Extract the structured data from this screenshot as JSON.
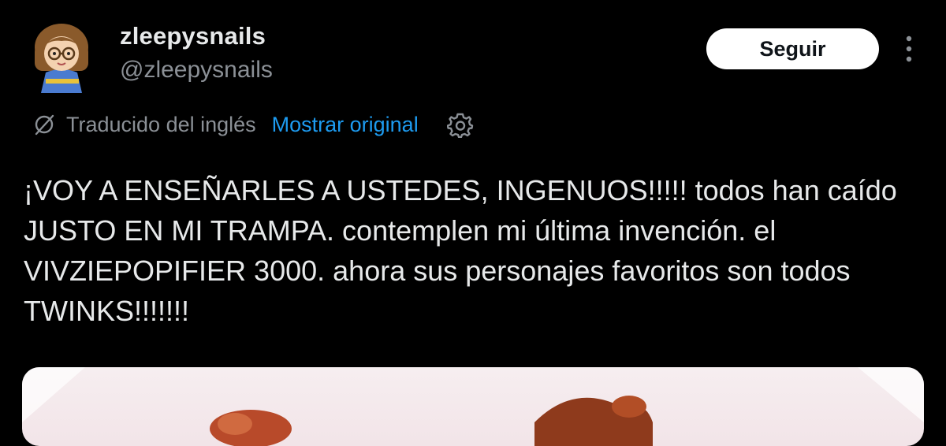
{
  "author": {
    "display_name": "zleepysnails",
    "handle": "@zleepysnails",
    "avatar_icon": "cartoon-girl-avatar"
  },
  "actions": {
    "follow_label": "Seguir",
    "more_icon": "vertical-ellipsis-icon"
  },
  "translation": {
    "label": "Traducido del inglés",
    "show_original": "Mostrar original",
    "translate_icon": "translate-icon",
    "settings_icon": "gear-icon"
  },
  "tweet": {
    "text": "¡VOY A ENSEÑARLES A USTEDES, INGENUOS!!!!! todos han caído JUSTO EN MI TRAMPA. contemplen mi última invención. el VIVZIEPOPIFIER 3000. ahora sus personajes favoritos son todos TWINKS!!!!!!!"
  },
  "theme": {
    "background": "#000000",
    "text": "#e7e9ea",
    "muted": "#8b9096",
    "link": "#1d9bf0",
    "button_bg": "#ffffff"
  }
}
